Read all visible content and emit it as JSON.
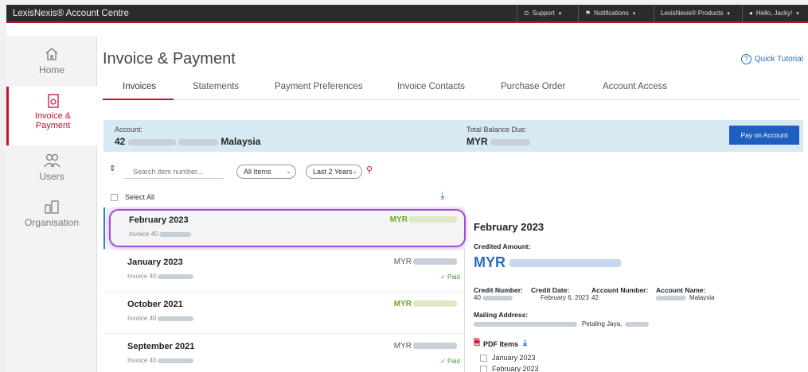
{
  "topbar": {
    "brand": "LexisNexis® Account Centre",
    "support": "Support",
    "notifications": "Notifications",
    "products": "LexisNexis® Products",
    "greeting": "Hello, Jacky!"
  },
  "sidebar": {
    "items": [
      {
        "label": "Home",
        "icon": "home-icon"
      },
      {
        "label": "Invoice & Payment",
        "icon": "invoice-icon"
      },
      {
        "label": "Users",
        "icon": "users-icon"
      },
      {
        "label": "Organisation",
        "icon": "organisation-icon"
      }
    ]
  },
  "page": {
    "title": "Invoice & Payment",
    "quick_tutorial": "Quick Tutorial"
  },
  "tabs": [
    "Invoices",
    "Statements",
    "Payment Preferences",
    "Invoice Contacts",
    "Purchase Order",
    "Account Access"
  ],
  "account": {
    "label": "Account:",
    "number_prefix": "42",
    "country": "Malaysia",
    "balance_label": "Total Balance Due:",
    "currency": "MYR",
    "pay_button": "Pay on Account"
  },
  "filters": {
    "search_placeholder": "Search item number...",
    "items_select": "All Items",
    "period_select": "Last 2 Years"
  },
  "list": {
    "select_all": "Select All",
    "rows": [
      {
        "title": "February 2023",
        "sub": "Invoice 40",
        "currency": "MYR",
        "status": ""
      },
      {
        "title": "January 2023",
        "sub": "Invoice 40",
        "currency": "MYR",
        "status": "✓ Paid"
      },
      {
        "title": "October 2021",
        "sub": "Invoice 40",
        "currency": "MYR",
        "status": ""
      },
      {
        "title": "September 2021",
        "sub": "Invoice 40",
        "currency": "MYR",
        "status": "✓ Paid"
      }
    ]
  },
  "detail": {
    "title": "February 2023",
    "credited_label": "Credited Amount:",
    "amount_currency": "MYR",
    "credit_number_label": "Credit Number:",
    "credit_number_val": "40",
    "credit_date_label": "Credit Date:",
    "credit_date_val": "February 6, 2023",
    "account_number_label": "Account Number:",
    "account_number_val": "42",
    "account_name_label": "Account Name:",
    "account_name_val": "Malaysia",
    "mailing_label": "Mailing Address:",
    "mailing_val": "Petaling Jaya,",
    "pdf_label": "PDF Items",
    "pdf_items": [
      "January 2023",
      "February 2023"
    ]
  }
}
